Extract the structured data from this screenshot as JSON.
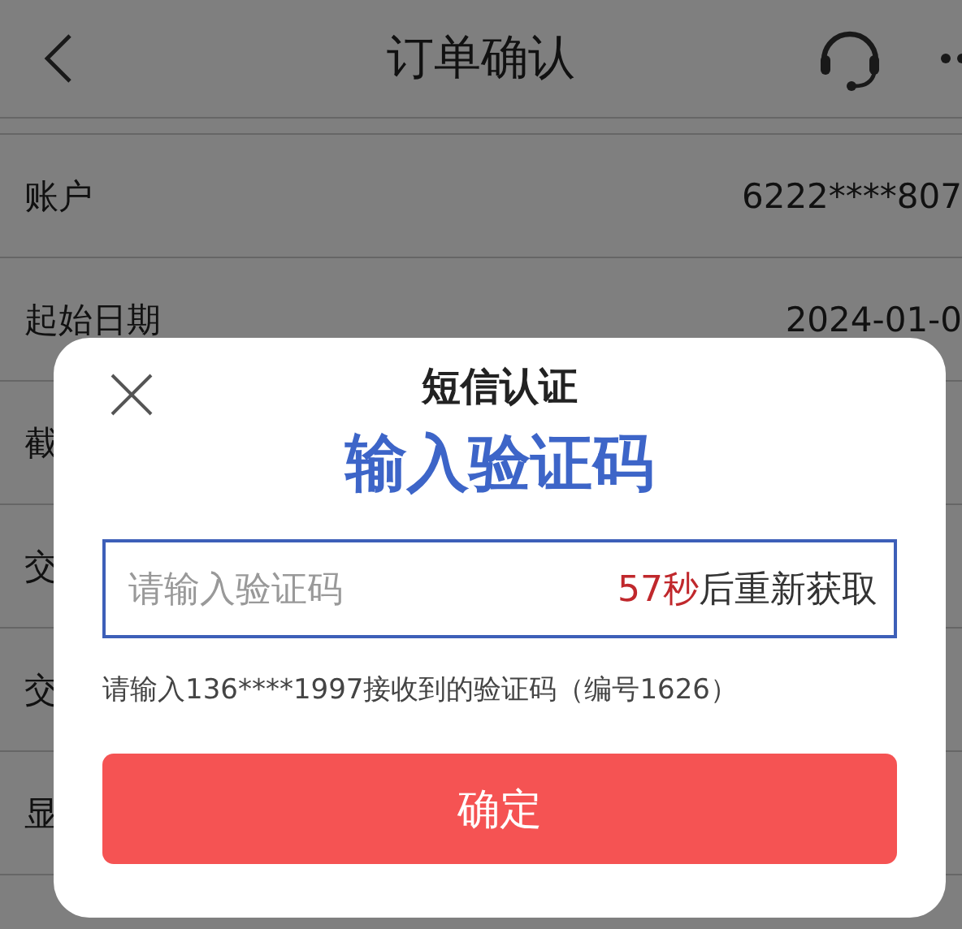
{
  "header": {
    "title": "订单确认"
  },
  "rows": [
    {
      "label": "账户",
      "value": "6222****807"
    },
    {
      "label": "起始日期",
      "value": "2024-01-0"
    },
    {
      "label": "截"
    },
    {
      "label": "交"
    },
    {
      "label": "交"
    },
    {
      "label": "显"
    }
  ],
  "dialog": {
    "title": "短信认证",
    "heading": "输入验证码",
    "input": {
      "placeholder": "请输入验证码"
    },
    "countdown": {
      "seconds": "57秒",
      "text": "后重新获取"
    },
    "hint": "请输入136****1997接收到的验证码（编号1626）",
    "confirm_button": "确定"
  }
}
